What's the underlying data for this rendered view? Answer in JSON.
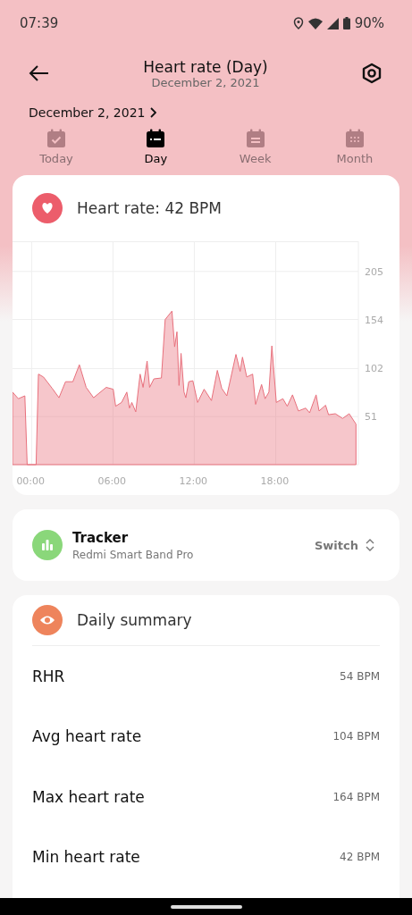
{
  "status_bar": {
    "time": "07:39",
    "battery": "90%"
  },
  "header": {
    "title": "Heart rate (Day)",
    "subtitle": "December 2, 2021"
  },
  "date_picker": {
    "label": "December 2, 2021"
  },
  "tabs": [
    {
      "label": "Today",
      "selected": false
    },
    {
      "label": "Day",
      "selected": true
    },
    {
      "label": "Week",
      "selected": false
    },
    {
      "label": "Month",
      "selected": false
    }
  ],
  "heart_card": {
    "title": "Heart rate: 42 BPM",
    "chart_data": {
      "type": "area",
      "grid": true,
      "xlim": [
        -1.41,
        24.1
      ],
      "ylim": [
        0,
        237
      ],
      "xticks": [
        {
          "value": 0,
          "label": "00:00"
        },
        {
          "value": 6,
          "label": "06:00"
        },
        {
          "value": 12,
          "label": "12:00"
        },
        {
          "value": 18,
          "label": "18:00"
        }
      ],
      "yticks": [
        51,
        102,
        154,
        205
      ],
      "x": [
        -1.41,
        -0.98,
        -0.5,
        -0.33,
        0.33,
        0.5,
        0.87,
        1.52,
        2.02,
        2.5,
        3.04,
        3.52,
        4.02,
        4.57,
        5.5,
        6.02,
        6.2,
        6.63,
        7.02,
        7.22,
        7.39,
        7.68,
        8.0,
        8.22,
        8.52,
        8.7,
        9.02,
        9.57,
        9.85,
        10.35,
        10.55,
        10.72,
        10.87,
        11.02,
        11.24,
        11.37,
        11.59,
        11.89,
        12.24,
        12.72,
        13.26,
        13.7,
        14.02,
        14.4,
        15.07,
        15.38,
        15.55,
        15.87,
        16.3,
        16.52,
        16.96,
        17.22,
        17.5,
        17.72,
        18.05,
        18.53,
        18.85,
        19.24,
        19.68,
        20.22,
        20.5,
        20.98,
        21.2,
        21.68,
        21.9,
        22.4,
        22.94,
        23.42,
        23.92
      ],
      "series": [
        {
          "color": "#e8707c",
          "values": [
            77,
            70,
            73,
            0,
            0,
            96,
            93,
            81,
            71,
            88,
            88,
            106,
            82,
            71,
            82,
            80,
            62,
            66,
            77,
            60,
            66,
            56,
            96,
            82,
            110,
            82,
            91,
            92,
            154,
            163,
            125,
            141,
            84,
            118,
            77,
            71,
            88,
            89,
            66,
            80,
            68,
            100,
            81,
            73,
            117,
            99,
            114,
            93,
            96,
            64,
            85,
            70,
            77,
            126,
            66,
            70,
            62,
            74,
            57,
            60,
            55,
            74,
            57,
            63,
            53,
            54,
            49,
            54,
            43
          ]
        }
      ]
    }
  },
  "tracker": {
    "title": "Tracker",
    "device": "Redmi Smart Band Pro",
    "action": "Switch"
  },
  "summary": {
    "title": "Daily summary",
    "rows": [
      {
        "label": "RHR",
        "value": "54 BPM"
      },
      {
        "label": "Avg heart rate",
        "value": "104 BPM"
      },
      {
        "label": "Max heart rate",
        "value": "164 BPM"
      },
      {
        "label": "Min heart rate",
        "value": "42 BPM"
      }
    ]
  }
}
